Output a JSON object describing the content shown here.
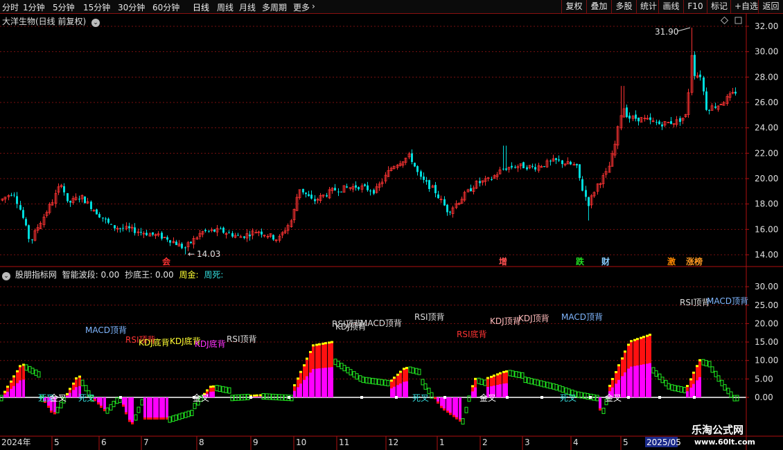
{
  "toolbar": {
    "periods": [
      "分时",
      "1分钟",
      "5分钟",
      "15分钟",
      "30分钟",
      "60分钟",
      "日线",
      "周线",
      "月线",
      "多周期",
      "更多"
    ],
    "active_period": "日线",
    "more_arrow": "chevron-right-icon",
    "right_buttons": [
      "复权",
      "叠加",
      "多股",
      "统计",
      "画线",
      "F10",
      "标记",
      "+自选",
      "返回"
    ]
  },
  "main_chart": {
    "title": "大洋生物(日线 前复权)",
    "high_label": "31.90",
    "low_label": "14.03",
    "y_ticks": [
      "32.00",
      "30.00",
      "28.00",
      "26.00",
      "24.00",
      "22.00",
      "20.00",
      "18.00",
      "16.00",
      "14.00"
    ],
    "events": [
      {
        "text": "会",
        "color": "#ff3333"
      },
      {
        "text": "增",
        "color": "#ff5050"
      },
      {
        "text": "跌",
        "color": "#22dd22"
      },
      {
        "text": "财",
        "color": "#88ccff"
      },
      {
        "text": "激",
        "color": "#ff8800"
      },
      {
        "text": "涨榜",
        "color": "#ff9922"
      }
    ]
  },
  "indicator": {
    "name": "股朋指标网",
    "label1": "智能波段:",
    "value1": "0.00",
    "label2": "抄底王:",
    "value2": "0.00",
    "label3": "周金:",
    "label4": "周死:",
    "y_ticks": [
      "30.00",
      "25.00",
      "20.00",
      "15.00",
      "10.00",
      "5.00",
      "0.00"
    ],
    "signals": [
      {
        "text": "MACD顶背",
        "color": "#7fb6ff"
      },
      {
        "text": "RSI顶背",
        "color": "#ff3333"
      },
      {
        "text": "KDJ底背",
        "color": "#ffff33"
      },
      {
        "text": "KDJ底背",
        "color": "#ffff33"
      },
      {
        "text": "KDJ底背",
        "color": "#ff33ff"
      },
      {
        "text": "RSI顶背",
        "color": "#dddddd"
      },
      {
        "text": "RSI顶背",
        "color": "#dddddd"
      },
      {
        "text": "KDJ顶背",
        "color": "#dddddd"
      },
      {
        "text": "MACD顶背",
        "color": "#dddddd"
      },
      {
        "text": "RSI顶背",
        "color": "#dddddd"
      },
      {
        "text": "RSI底背",
        "color": "#ff3333"
      },
      {
        "text": "KDJ顶背",
        "color": "#ffbbbb"
      },
      {
        "text": "KDJ顶背",
        "color": "#ffbbbb"
      },
      {
        "text": "MACD顶背",
        "color": "#7fb6ff"
      },
      {
        "text": "RSI顶背",
        "color": "#dddddd"
      },
      {
        "text": "MACD顶背",
        "color": "#7fb6ff"
      }
    ],
    "crosses": [
      "死叉",
      "金叉",
      "死叉",
      "金叉",
      "死叉",
      "金叉",
      "死叉",
      "金叉"
    ]
  },
  "x_axis": {
    "labels": [
      "2024年",
      "5",
      "6",
      "7",
      "8",
      "9",
      "10",
      "11",
      "12",
      "1",
      "2",
      "3",
      "4",
      "5",
      "2025/05"
    ]
  },
  "watermark": {
    "main": "乐淘公式网",
    "url": "www.60lt.com"
  },
  "colors": {
    "up": "#ff3333",
    "down": "#00dddd",
    "grid": "#7a1010",
    "axis": "#b01010"
  }
}
